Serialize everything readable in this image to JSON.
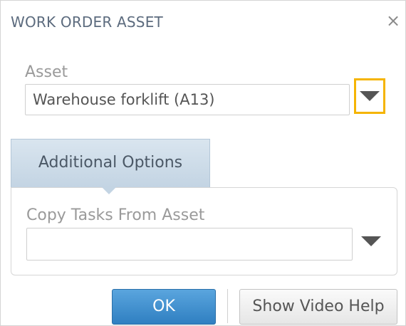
{
  "dialog": {
    "title": "WORK ORDER ASSET",
    "close_icon": "close-icon"
  },
  "asset": {
    "label": "Asset",
    "value": "Warehouse forklift (A13)",
    "dropdown_icon": "triangle-down-icon"
  },
  "tabs": [
    {
      "label": "Additional Options",
      "active": true
    }
  ],
  "copy_tasks": {
    "label": "Copy Tasks From Asset",
    "value": "",
    "dropdown_icon": "triangle-down-icon"
  },
  "buttons": {
    "ok_label": "OK",
    "help_label": "Show Video Help"
  },
  "colors": {
    "focus_outline": "#f5b400",
    "primary_button": "#3a8ccc",
    "tab_background": "#c9d9e7"
  }
}
